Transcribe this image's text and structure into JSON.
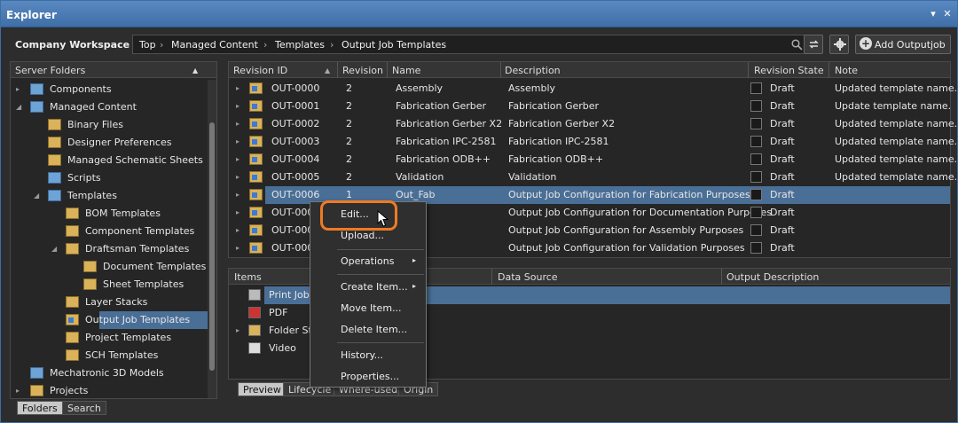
{
  "window": {
    "title": "Explorer",
    "pin_glyph": "▾",
    "close_glyph": "✕"
  },
  "toolbar": {
    "workspace": "Company Workspace",
    "workspace_caret": "▾",
    "breadcrumb": [
      "Top",
      "Managed Content",
      "Templates",
      "Output Job Templates"
    ],
    "separator": "›",
    "add_label": "Add Outputjob",
    "plus": "+"
  },
  "folders": {
    "header": "Server Folders",
    "items": [
      {
        "label": "Components",
        "depth": 0,
        "arrow": "▸",
        "icon": "blue"
      },
      {
        "label": "Managed Content",
        "depth": 0,
        "arrow": "◢",
        "icon": "blue"
      },
      {
        "label": "Binary Files",
        "depth": 1,
        "arrow": "",
        "icon": "folder"
      },
      {
        "label": "Designer Preferences",
        "depth": 1,
        "arrow": "",
        "icon": "folder"
      },
      {
        "label": "Managed Schematic Sheets",
        "depth": 1,
        "arrow": "",
        "icon": "folder"
      },
      {
        "label": "Scripts",
        "depth": 1,
        "arrow": "",
        "icon": "blue"
      },
      {
        "label": "Templates",
        "depth": 1,
        "arrow": "◢",
        "icon": "blue"
      },
      {
        "label": "BOM Templates",
        "depth": 2,
        "arrow": "",
        "icon": "folder"
      },
      {
        "label": "Component Templates",
        "depth": 2,
        "arrow": "",
        "icon": "folder"
      },
      {
        "label": "Draftsman Templates",
        "depth": 2,
        "arrow": "◢",
        "icon": "folder"
      },
      {
        "label": "Document Templates",
        "depth": 3,
        "arrow": "",
        "icon": "folder"
      },
      {
        "label": "Sheet Templates",
        "depth": 3,
        "arrow": "",
        "icon": "folder"
      },
      {
        "label": "Layer Stacks",
        "depth": 2,
        "arrow": "",
        "icon": "folder"
      },
      {
        "label": "Output Job Templates",
        "depth": 2,
        "arrow": "",
        "icon": "out",
        "selected": true
      },
      {
        "label": "Project Templates",
        "depth": 2,
        "arrow": "",
        "icon": "folder"
      },
      {
        "label": "SCH Templates",
        "depth": 2,
        "arrow": "",
        "icon": "folder"
      },
      {
        "label": "Mechatronic 3D Models",
        "depth": 0,
        "arrow": "",
        "icon": "blue"
      },
      {
        "label": "Projects",
        "depth": 0,
        "arrow": "▸",
        "icon": "folder"
      }
    ],
    "tabs": [
      "Folders",
      "Search"
    ]
  },
  "revisions": {
    "columns": [
      "Revision ID",
      "Revision",
      "Name",
      "Description",
      "Revision State",
      "Note"
    ],
    "sort_glyph": "▲",
    "rows": [
      {
        "id": "OUT-0000",
        "rev": "2",
        "name": "Assembly",
        "desc": "Assembly",
        "state": "Draft",
        "note": "Updated template name."
      },
      {
        "id": "OUT-0001",
        "rev": "2",
        "name": "Fabrication Gerber",
        "desc": "Fabrication Gerber",
        "state": "Draft",
        "note": "Update template name."
      },
      {
        "id": "OUT-0002",
        "rev": "2",
        "name": "Fabrication Gerber X2",
        "desc": "Fabrication Gerber X2",
        "state": "Draft",
        "note": "Updated template name."
      },
      {
        "id": "OUT-0003",
        "rev": "2",
        "name": "Fabrication IPC-2581",
        "desc": "Fabrication IPC-2581",
        "state": "Draft",
        "note": "Updated template name."
      },
      {
        "id": "OUT-0004",
        "rev": "2",
        "name": "Fabrication ODB++",
        "desc": "Fabrication ODB++",
        "state": "Draft",
        "note": "Updated template name."
      },
      {
        "id": "OUT-0005",
        "rev": "2",
        "name": "Validation",
        "desc": "Validation",
        "state": "Draft",
        "note": "Updated template name."
      },
      {
        "id": "OUT-0006",
        "rev": "1",
        "name": "Out_Fab",
        "desc": "Output Job Configuration for Fabrication Purposes",
        "state": "Draft",
        "note": "",
        "selected": true
      },
      {
        "id": "OUT-000",
        "rev": "",
        "name": "c",
        "desc": "Output Job Configuration for Documentation Purposes",
        "state": "Draft",
        "note": ""
      },
      {
        "id": "OUT-000",
        "rev": "",
        "name": "sy",
        "desc": "Output Job Configuration for Assembly Purposes",
        "state": "Draft",
        "note": ""
      },
      {
        "id": "OUT-000",
        "rev": "",
        "name": "",
        "desc": "Output Job Configuration for Validation Purposes",
        "state": "Draft",
        "note": ""
      }
    ]
  },
  "items": {
    "columns": [
      "Items",
      "Data Source",
      "Output Description"
    ],
    "rows": [
      {
        "label": "Print Job",
        "selected": true
      },
      {
        "label": "PDF"
      },
      {
        "label": "Folder St"
      },
      {
        "label": "Video"
      }
    ],
    "tabs": [
      "Preview",
      "Lifecycle",
      "Where-used",
      "Origin"
    ]
  },
  "context_menu": {
    "items": [
      "Edit...",
      "Upload...",
      "Operations",
      "Create Item...",
      "Move Item...",
      "Delete Item...",
      "History...",
      "Properties..."
    ],
    "submenu_glyph": "▸"
  },
  "colors": {
    "accent": "#f07a22",
    "selection": "#4a6f97",
    "titlebar": "#4a7ab4"
  }
}
